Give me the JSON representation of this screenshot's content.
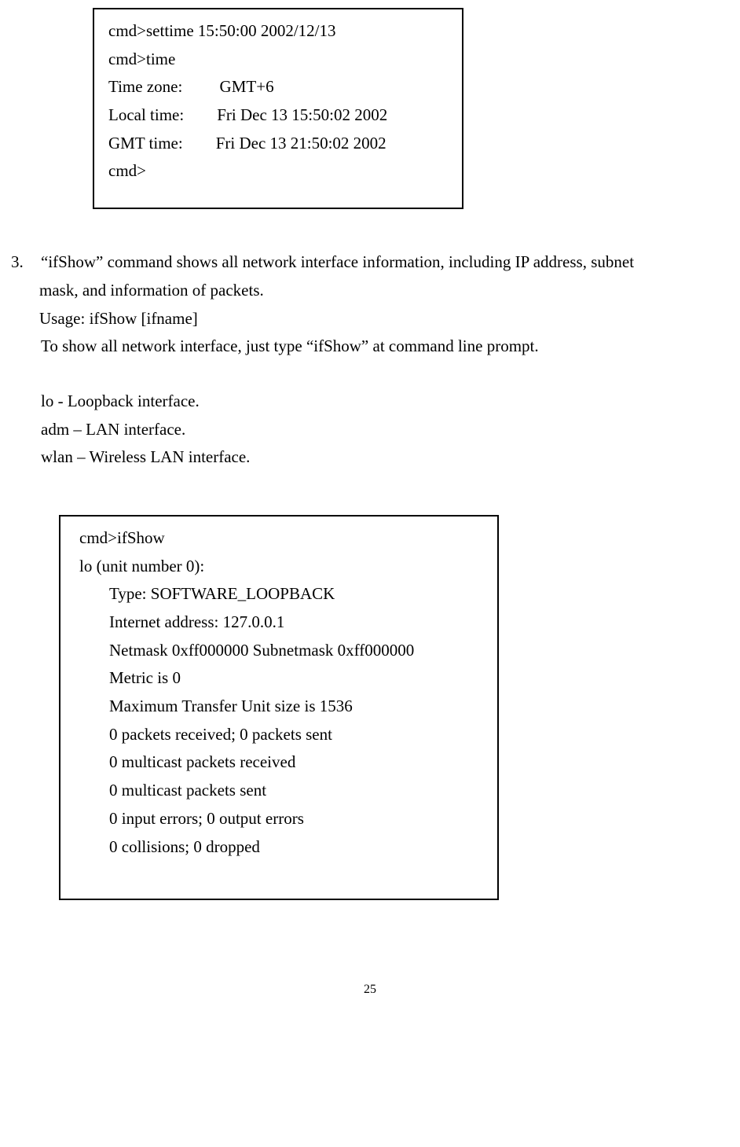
{
  "box1": {
    "l1": "cmd>settime 15:50:00 2002/12/13",
    "l2": "cmd>time",
    "l3": "Time zone:         GMT+6",
    "l4": "Local time:        Fri Dec 13 15:50:02 2002",
    "l5": "GMT time:        Fri Dec 13 21:50:02 2002",
    "l6": "cmd>"
  },
  "item3": {
    "num": "3.",
    "p1a": "“ifShow” command shows all network interface information, including IP address, subnet",
    "p1b": "mask, and information of packets.",
    "p2": "Usage: ifShow [ifname]",
    "p3": "To show all network interface, just type “ifShow” at command line prompt.",
    "p4": "lo - Loopback interface.",
    "p5": "adm – LAN interface.",
    "p6": "wlan – Wireless LAN interface."
  },
  "box2": {
    "l1": "cmd>ifShow",
    "l2": "lo (unit number 0):",
    "l3": "Type: SOFTWARE_LOOPBACK",
    "l4": "Internet address: 127.0.0.1",
    "l5": "Netmask 0xff000000 Subnetmask 0xff000000",
    "l6": "Metric is 0",
    "l7": "Maximum Transfer Unit size is 1536",
    "l8": "0 packets received; 0 packets sent",
    "l9": "0 multicast packets received",
    "l10": "0 multicast packets sent",
    "l11": "0 input errors; 0 output errors",
    "l12": "0 collisions; 0 dropped"
  },
  "pageNumber": "25"
}
